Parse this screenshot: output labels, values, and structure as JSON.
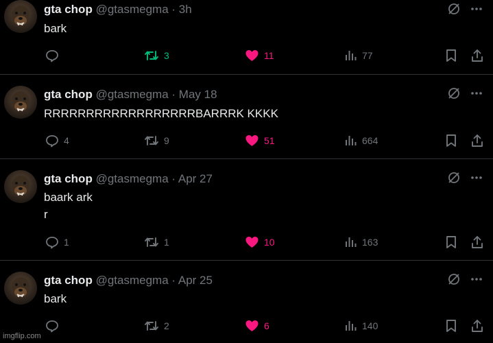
{
  "tweets": [
    {
      "name": "gta chop",
      "handle": "@gtasmegma",
      "dot": "·",
      "time": "3h",
      "text": "bark",
      "replies": "",
      "retweets": "3",
      "likes": "11",
      "views": "77",
      "retweeted": true
    },
    {
      "name": "gta chop",
      "handle": "@gtasmegma",
      "dot": "·",
      "time": "May 18",
      "text": "RRRRRRRRRRRRRRRRRRBARRRK KKKK",
      "replies": "4",
      "retweets": "9",
      "likes": "51",
      "views": "664",
      "retweeted": false
    },
    {
      "name": "gta chop",
      "handle": "@gtasmegma",
      "dot": "·",
      "time": "Apr 27",
      "text": "baark ark\nr",
      "replies": "1",
      "retweets": "1",
      "likes": "10",
      "views": "163",
      "retweeted": false
    },
    {
      "name": "gta chop",
      "handle": "@gtasmegma",
      "dot": "·",
      "time": "Apr 25",
      "text": "bark",
      "replies": "",
      "retweets": "2",
      "likes": "6",
      "views": "140",
      "retweeted": false
    }
  ],
  "colors": {
    "retweet_active": "#00ba7c",
    "like_active": "#f91880",
    "muted": "#71767b"
  },
  "watermark": "imgflip.com"
}
